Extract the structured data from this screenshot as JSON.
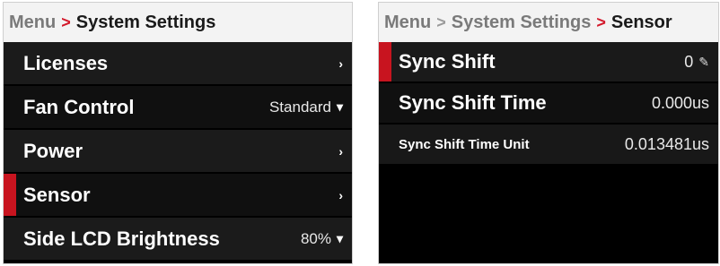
{
  "left": {
    "breadcrumb": {
      "root": "Menu",
      "separator": ">",
      "current": "System Settings"
    },
    "items": [
      {
        "label": "Licenses",
        "value": "",
        "indicator": "chevron-right"
      },
      {
        "label": "Fan Control",
        "value": "Standard",
        "indicator": "chevron-down"
      },
      {
        "label": "Power",
        "value": "",
        "indicator": "chevron-right"
      },
      {
        "label": "Sensor",
        "value": "",
        "indicator": "chevron-right",
        "selected": true
      },
      {
        "label": "Side LCD Brightness",
        "value": "80%",
        "indicator": "chevron-down"
      }
    ]
  },
  "right": {
    "breadcrumb": {
      "root": "Menu",
      "separator1": ">",
      "middle": "System Settings",
      "separator2": ">",
      "current": "Sensor"
    },
    "items": [
      {
        "label": "Sync Shift",
        "value": "0",
        "indicator": "edit-icon",
        "selected": true
      },
      {
        "label": "Sync Shift Time",
        "value": "0.000us"
      },
      {
        "label": "Sync Shift Time Unit",
        "value": "0.013481us"
      }
    ]
  },
  "glyphs": {
    "chevron_right": "›",
    "chevron_down": "▾",
    "edit": "✎"
  },
  "colors": {
    "accent": "#c8141f",
    "background": "#000000",
    "breadcrumb_bg": "#f3f3f3"
  }
}
